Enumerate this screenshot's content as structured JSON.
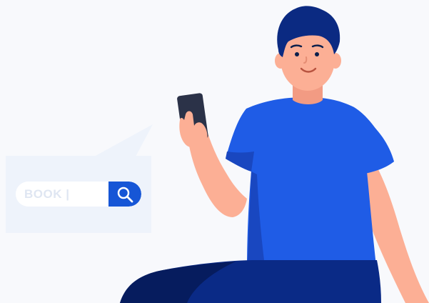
{
  "search": {
    "value": "BOOK |",
    "button_icon": "search-icon"
  },
  "colors": {
    "background": "#f8f9fc",
    "bubble": "#eef3fb",
    "accent": "#1656d6",
    "shirt": "#1f5ce6",
    "hair": "#0b2a82",
    "skin": "#fcaf95",
    "phone": "#2b3248",
    "pants": "#0a2a86"
  }
}
